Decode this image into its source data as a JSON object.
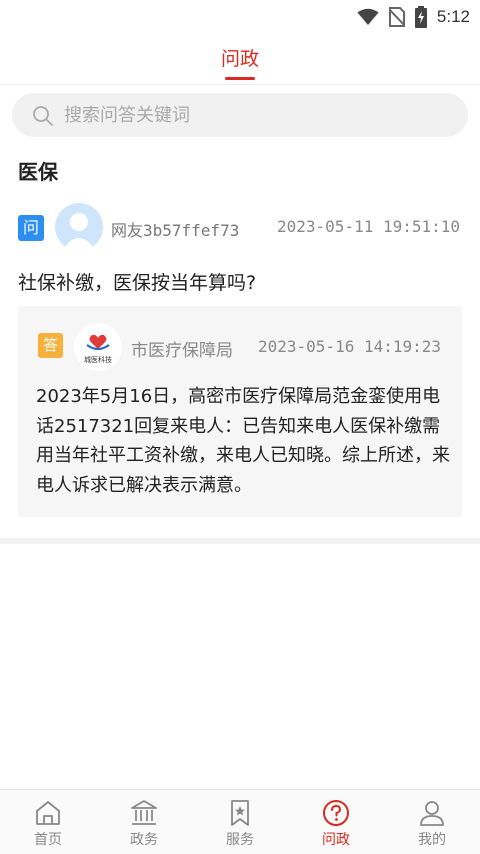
{
  "status_bar": {
    "time": "5:12",
    "icons": [
      "wifi-icon",
      "no-sim-icon",
      "battery-charging-icon"
    ]
  },
  "header": {
    "title": "问政"
  },
  "search": {
    "placeholder": "搜索问答关键词"
  },
  "section": {
    "title": "医保"
  },
  "question": {
    "tag": "问",
    "user": "网友3b57ffef73",
    "time": "2023-05-11 19:51:10",
    "text": "社保补缴，医保按当年算吗?"
  },
  "answer": {
    "tag": "答",
    "logo_text": "城医科技",
    "org": "市医疗保障局",
    "time": "2023-05-16 14:19:23",
    "text": "2023年5月16日，高密市医疗保障局范金銮使用电话2517321回复来电人：已告知来电人医保补缴需用当年社平工资补缴，来电人已知晓。综上所述，来电人诉求已解决表示满意。"
  },
  "tabbar": {
    "items": [
      {
        "label": "首页",
        "icon": "home-icon"
      },
      {
        "label": "政务",
        "icon": "government-icon"
      },
      {
        "label": "服务",
        "icon": "bookmark-star-icon"
      },
      {
        "label": "问政",
        "icon": "question-circle-icon",
        "active": true
      },
      {
        "label": "我的",
        "icon": "user-icon"
      }
    ]
  },
  "colors": {
    "accent": "#d92b20",
    "question_tag": "#2b8ef0",
    "answer_tag": "#f6b03c"
  }
}
